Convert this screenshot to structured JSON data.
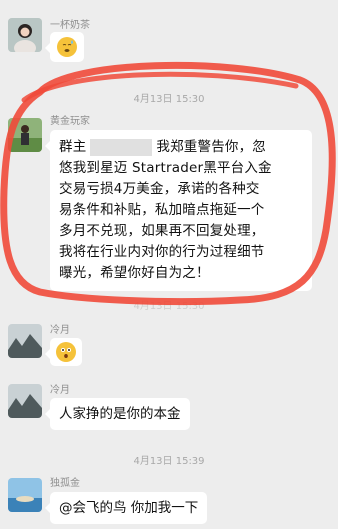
{
  "messages": [
    {
      "sender": "一杯奶茶",
      "content_type": "emoji",
      "emoji": "sweat-face-emoji"
    },
    {
      "timestamp": "4月13日 15:30"
    },
    {
      "sender": "黄金玩家",
      "line1_prefix": "群主",
      "line1_suffix": "我郑重警告你，忽",
      "rest_lines": [
        "悠我到星迈 Startrader黑平台入金",
        "交易亏损4万美金，承诺的各种交",
        "易条件和补贴，私加暗点拖延一个",
        "多月不兑现，如果再不回复处理，",
        "我将在行业内对你的行为过程细节",
        "曝光，希望你好自为之！"
      ]
    },
    {
      "timestamp": "4月13日 15:30"
    },
    {
      "sender": "冷月",
      "content_type": "emoji",
      "emoji": "surprised-face-emoji"
    },
    {
      "sender": "冷月",
      "text": "人家挣的是你的本金"
    },
    {
      "timestamp": "4月13日 15:39"
    },
    {
      "sender": "独孤金",
      "text": "@会飞的鸟 你加我一下"
    }
  ],
  "colors": {
    "annotation": "#f04a3a",
    "bubble": "#ffffff",
    "background": "#ededed"
  }
}
